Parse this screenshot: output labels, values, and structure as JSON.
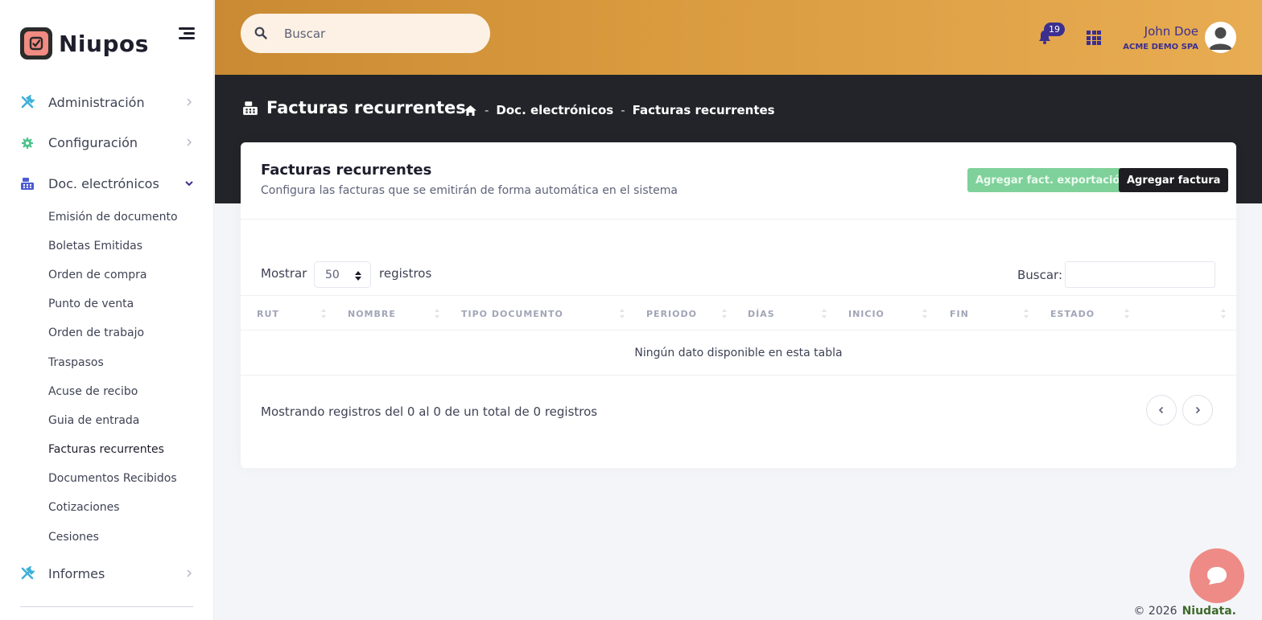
{
  "brand": {
    "name": "Niupos"
  },
  "sidebar": {
    "items": [
      {
        "label": "Administración",
        "icon": "tools-icon"
      },
      {
        "label": "Configuración",
        "icon": "gear-icon"
      },
      {
        "label": "Doc. electrónicos",
        "icon": "cash-register-icon",
        "expanded": true
      },
      {
        "label": "Informes",
        "icon": "tools-icon"
      }
    ],
    "submenu": [
      "Emisión de documento",
      "Boletas Emitidas",
      "Orden de compra",
      "Punto de venta",
      "Orden de trabajo",
      "Traspasos",
      "Acuse de recibo",
      "Guia de entrada",
      "Facturas recurrentes",
      "Documentos Recibidos",
      "Cotizaciones",
      "Cesiones"
    ],
    "active_submenu": "Facturas recurrentes"
  },
  "header": {
    "search_placeholder": "Buscar",
    "notification_count": "19",
    "user_name": "John Doe",
    "user_org": "ACME DEMO SPA"
  },
  "page": {
    "title": "Facturas recurrentes",
    "breadcrumb": [
      "Doc. electrónicos",
      "Facturas recurrentes"
    ],
    "separator": "-"
  },
  "card": {
    "title": "Facturas recurrentes",
    "subtitle": "Configura las facturas que se emitirán de forma automática en el sistema",
    "export_button": "Agregar fact. exportación",
    "add_button": "Agregar factura"
  },
  "table": {
    "show_label": "Mostrar",
    "page_size": "50",
    "records_label": "registros",
    "search_label": "Buscar:",
    "columns": [
      "RUT",
      "NOMBRE",
      "TIPO DOCUMENTO",
      "PERIODO",
      "DÍAS",
      "INICIO",
      "FIN",
      "ESTADO",
      ""
    ],
    "empty_message": "Ningún dato disponible en esta tabla",
    "info": "Mostrando registros del 0 al 0 de un total de 0 registros"
  },
  "footer": {
    "copyright": "© 2026",
    "company": "Niudata."
  },
  "colors": {
    "topbar_start": "#c98a33",
    "topbar_end": "#e8ac52",
    "dark_band": "#222429",
    "accent_purple": "#3c2f8f",
    "export_green": "#7fd19a",
    "chat_button": "#ee8b86"
  }
}
